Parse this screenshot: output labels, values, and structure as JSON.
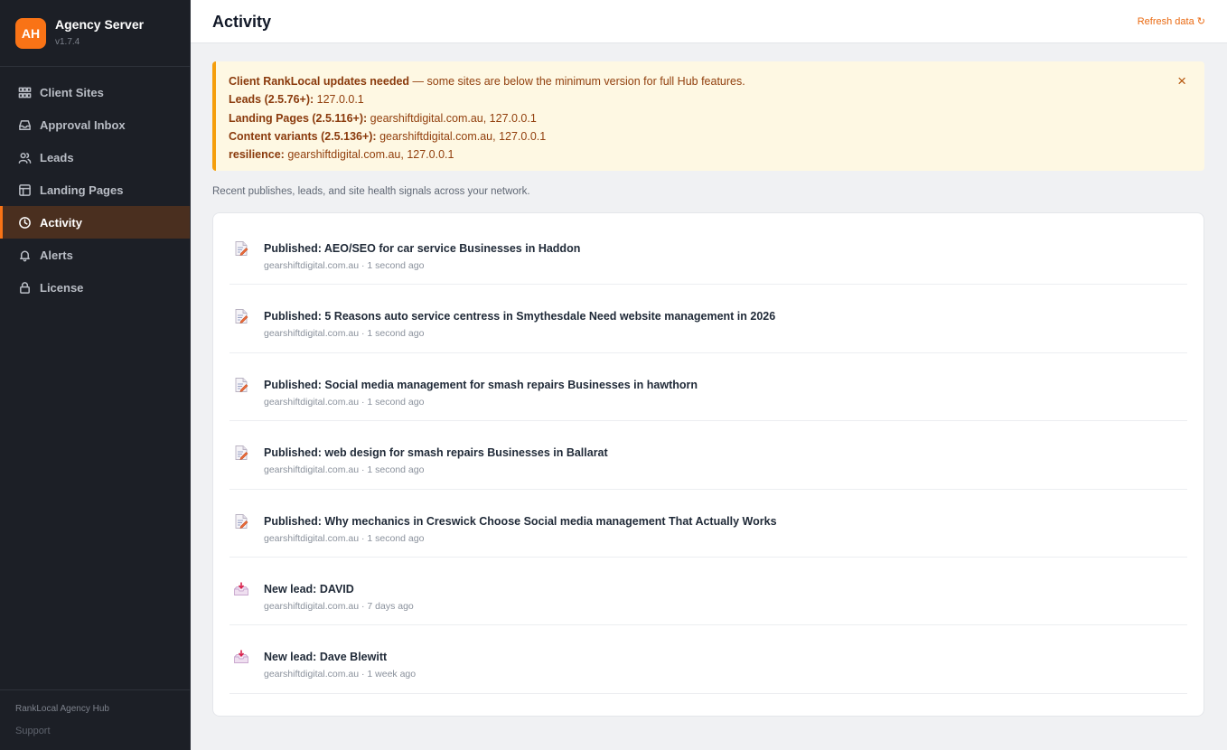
{
  "brand": {
    "logo": "AH",
    "name": "Agency Server",
    "version": "v1.7.4"
  },
  "nav": [
    {
      "label": "Client Sites",
      "icon": "grid-icon"
    },
    {
      "label": "Approval Inbox",
      "icon": "inbox-icon"
    },
    {
      "label": "Leads",
      "icon": "users-icon"
    },
    {
      "label": "Landing Pages",
      "icon": "layout-icon"
    },
    {
      "label": "Activity",
      "icon": "clock-icon",
      "active": true
    },
    {
      "label": "Alerts",
      "icon": "bell-icon"
    },
    {
      "label": "License",
      "icon": "lock-icon"
    }
  ],
  "footer": {
    "hub": "RankLocal Agency Hub",
    "support": "Support"
  },
  "header": {
    "title": "Activity",
    "refresh": "Refresh data ↻"
  },
  "alert": {
    "headline_bold": "Client RankLocal updates needed",
    "headline_rest": " — some sites are below the minimum version for full Hub features.",
    "lines": [
      {
        "label": "Leads (2.5.76+):",
        "value": " 127.0.0.1"
      },
      {
        "label": "Landing Pages (2.5.116+):",
        "value": " gearshiftdigital.com.au, 127.0.0.1"
      },
      {
        "label": "Content variants (2.5.136+):",
        "value": " gearshiftdigital.com.au, 127.0.0.1"
      },
      {
        "label": "resilience:",
        "value": " gearshiftdigital.com.au, 127.0.0.1"
      }
    ],
    "close": "×"
  },
  "subtitle": "Recent publishes, leads, and site health signals across your network.",
  "activity": [
    {
      "type": "publish",
      "title": "Published: AEO/SEO for car service Businesses in Haddon",
      "meta": "gearshiftdigital.com.au · 1 second ago"
    },
    {
      "type": "publish",
      "title": "Published: 5 Reasons auto service centress in Smythesdale Need website management in 2026",
      "meta": "gearshiftdigital.com.au · 1 second ago"
    },
    {
      "type": "publish",
      "title": "Published: Social media management for smash repairs Businesses in hawthorn",
      "meta": "gearshiftdigital.com.au · 1 second ago"
    },
    {
      "type": "publish",
      "title": "Published: web design for smash repairs Businesses in Ballarat",
      "meta": "gearshiftdigital.com.au · 1 second ago"
    },
    {
      "type": "publish",
      "title": "Published: Why mechanics in Creswick Choose Social media management That Actually Works",
      "meta": "gearshiftdigital.com.au · 1 second ago"
    },
    {
      "type": "lead",
      "title": "New lead: DAVID",
      "meta": "gearshiftdigital.com.au · 7 days ago"
    },
    {
      "type": "lead",
      "title": "New lead: Dave Blewitt",
      "meta": "gearshiftdigital.com.au · 1 week ago"
    }
  ],
  "colors": {
    "accent": "#f97316",
    "sidebar": "#1c1f26",
    "active_bg": "#4a2f1f",
    "alert_bg": "#fef8e3",
    "alert_border": "#f59e0b"
  }
}
